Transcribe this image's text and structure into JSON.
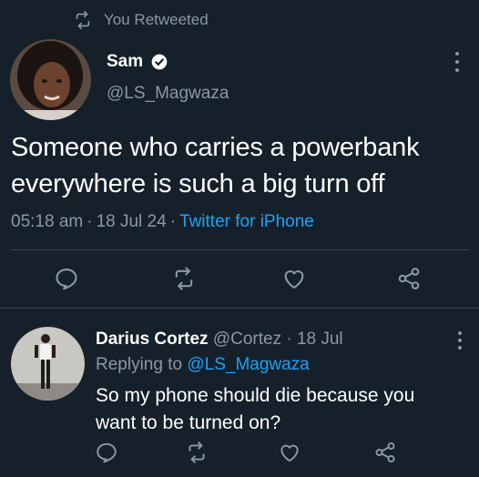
{
  "retweet_banner": {
    "text": "You Retweeted",
    "icon": "retweet-icon"
  },
  "main_tweet": {
    "author_name": "Sam",
    "verified": true,
    "handle": "@LS_Magwaza",
    "text_line1": "Someone who carries a powerbank",
    "text_line2": "everywhere is such a big turn off",
    "time": "05:18 am",
    "date": "18 Jul 24",
    "source": "Twitter for iPhone",
    "separator": "·"
  },
  "reply_tweet": {
    "author_name": "Darius Cortez",
    "handle": "@Cortez",
    "date": "18 Jul",
    "separator": "·",
    "replying_to_prefix": "Replying to",
    "replying_to_handle": "@LS_Magwaza",
    "text_line1": "So my phone should die because you",
    "text_line2": "want to be turned on?"
  },
  "colors": {
    "background": "#15202b",
    "muted": "#8899a6",
    "link": "#1da1f2",
    "divider": "#38444d",
    "verified_badge": "#ffffff"
  }
}
